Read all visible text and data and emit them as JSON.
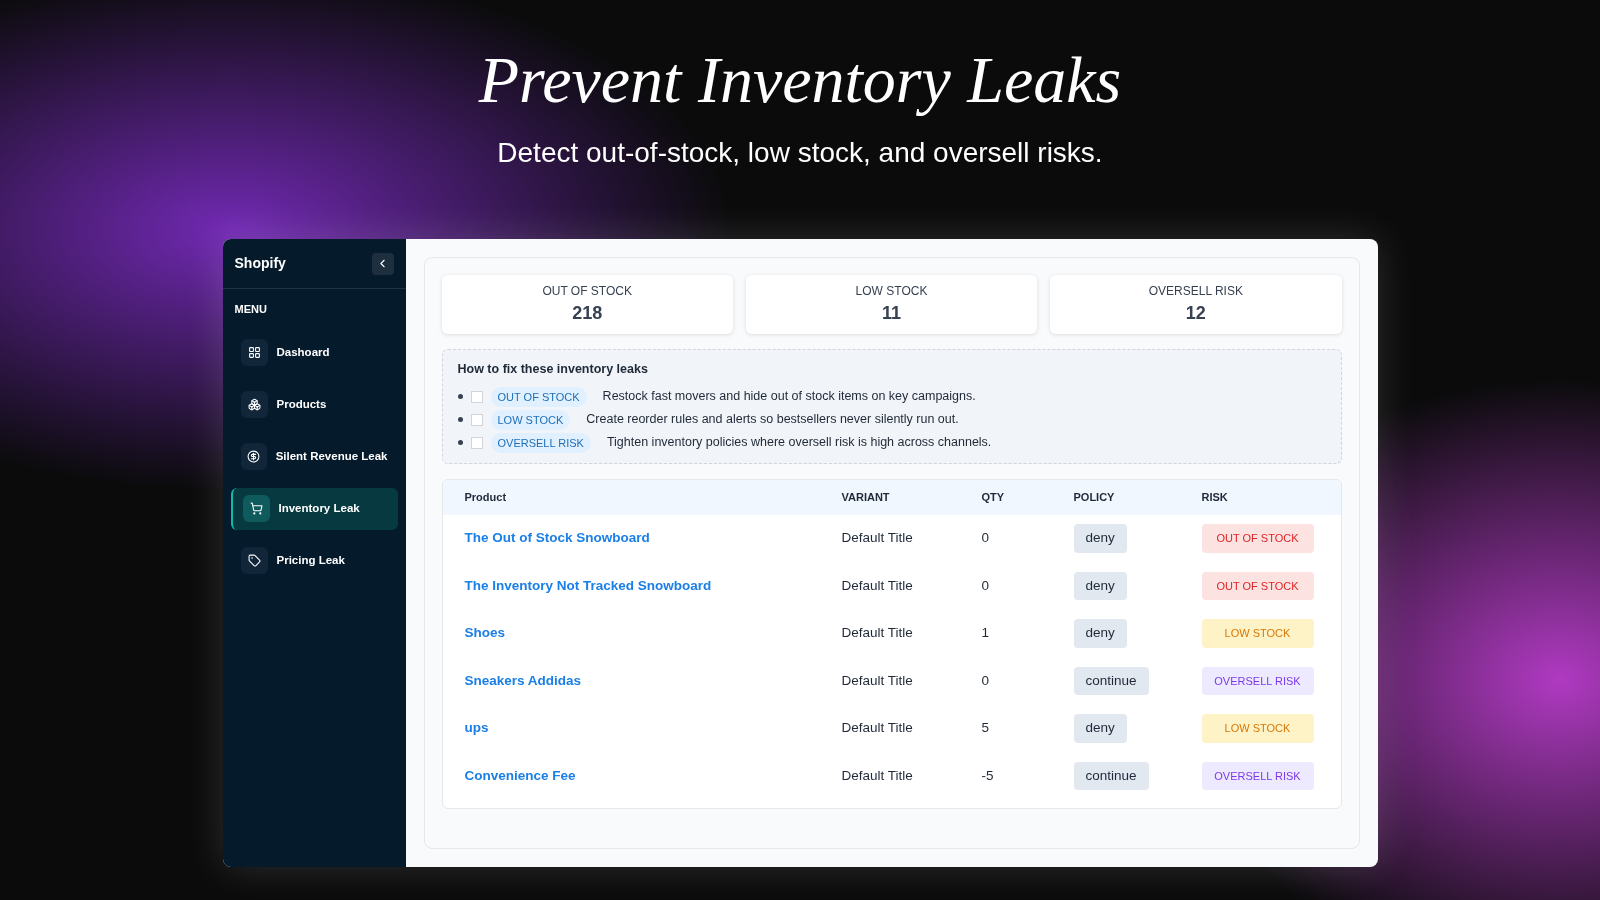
{
  "headline": "Prevent Inventory Leaks",
  "subtitle": "Detect out-of-stock, low stock, and oversell risks.",
  "sidebar": {
    "brand": "Shopify",
    "section": "MENU",
    "items": [
      {
        "label": "Dashoard",
        "selected": false
      },
      {
        "label": "Products",
        "selected": false
      },
      {
        "label": "Silent Revenue Leak",
        "selected": false
      },
      {
        "label": "Inventory Leak",
        "selected": true
      },
      {
        "label": "Pricing Leak",
        "selected": false
      }
    ]
  },
  "stats": [
    {
      "label": "OUT OF STOCK",
      "value": "218"
    },
    {
      "label": "LOW STOCK",
      "value": "11"
    },
    {
      "label": "OVERSELL RISK",
      "value": "12"
    }
  ],
  "tips": {
    "title": "How to fix these inventory leaks",
    "items": [
      {
        "tag": "OUT OF STOCK",
        "text": "Restock fast movers and hide out of stock items on key campaigns.",
        "checked": false
      },
      {
        "tag": "LOW STOCK",
        "text": "Create reorder rules and alerts so bestsellers never silently run out.",
        "checked": false
      },
      {
        "tag": "OVERSELL RISK",
        "text": "Tighten inventory policies where oversell risk is high across channels.",
        "checked": false
      }
    ]
  },
  "table": {
    "columns": [
      "Product",
      "VARIANT",
      "QTY",
      "POLICY",
      "RISK"
    ],
    "rows": [
      {
        "product": "The Out of Stock Snowboard",
        "variant": "Default Title",
        "qty": "0",
        "policy": "deny",
        "risk": {
          "kind": "out",
          "label": "OUT OF STOCK"
        }
      },
      {
        "product": "The Inventory Not Tracked Snowboard",
        "variant": "Default Title",
        "qty": "0",
        "policy": "deny",
        "risk": {
          "kind": "out",
          "label": "OUT OF STOCK"
        }
      },
      {
        "product": "Shoes",
        "variant": "Default Title",
        "qty": "1",
        "policy": "deny",
        "risk": {
          "kind": "low",
          "label": "LOW STOCK"
        }
      },
      {
        "product": "Sneakers Addidas",
        "variant": "Default Title",
        "qty": "0",
        "policy": "continue",
        "risk": {
          "kind": "oversell",
          "label": "OVERSELL RISK"
        }
      },
      {
        "product": "ups",
        "variant": "Default Title",
        "qty": "5",
        "policy": "deny",
        "risk": {
          "kind": "low",
          "label": "LOW STOCK"
        }
      },
      {
        "product": "Convenience Fee",
        "variant": "Default Title",
        "qty": "-5",
        "policy": "continue",
        "risk": {
          "kind": "oversell",
          "label": "OVERSELL RISK"
        }
      }
    ]
  }
}
